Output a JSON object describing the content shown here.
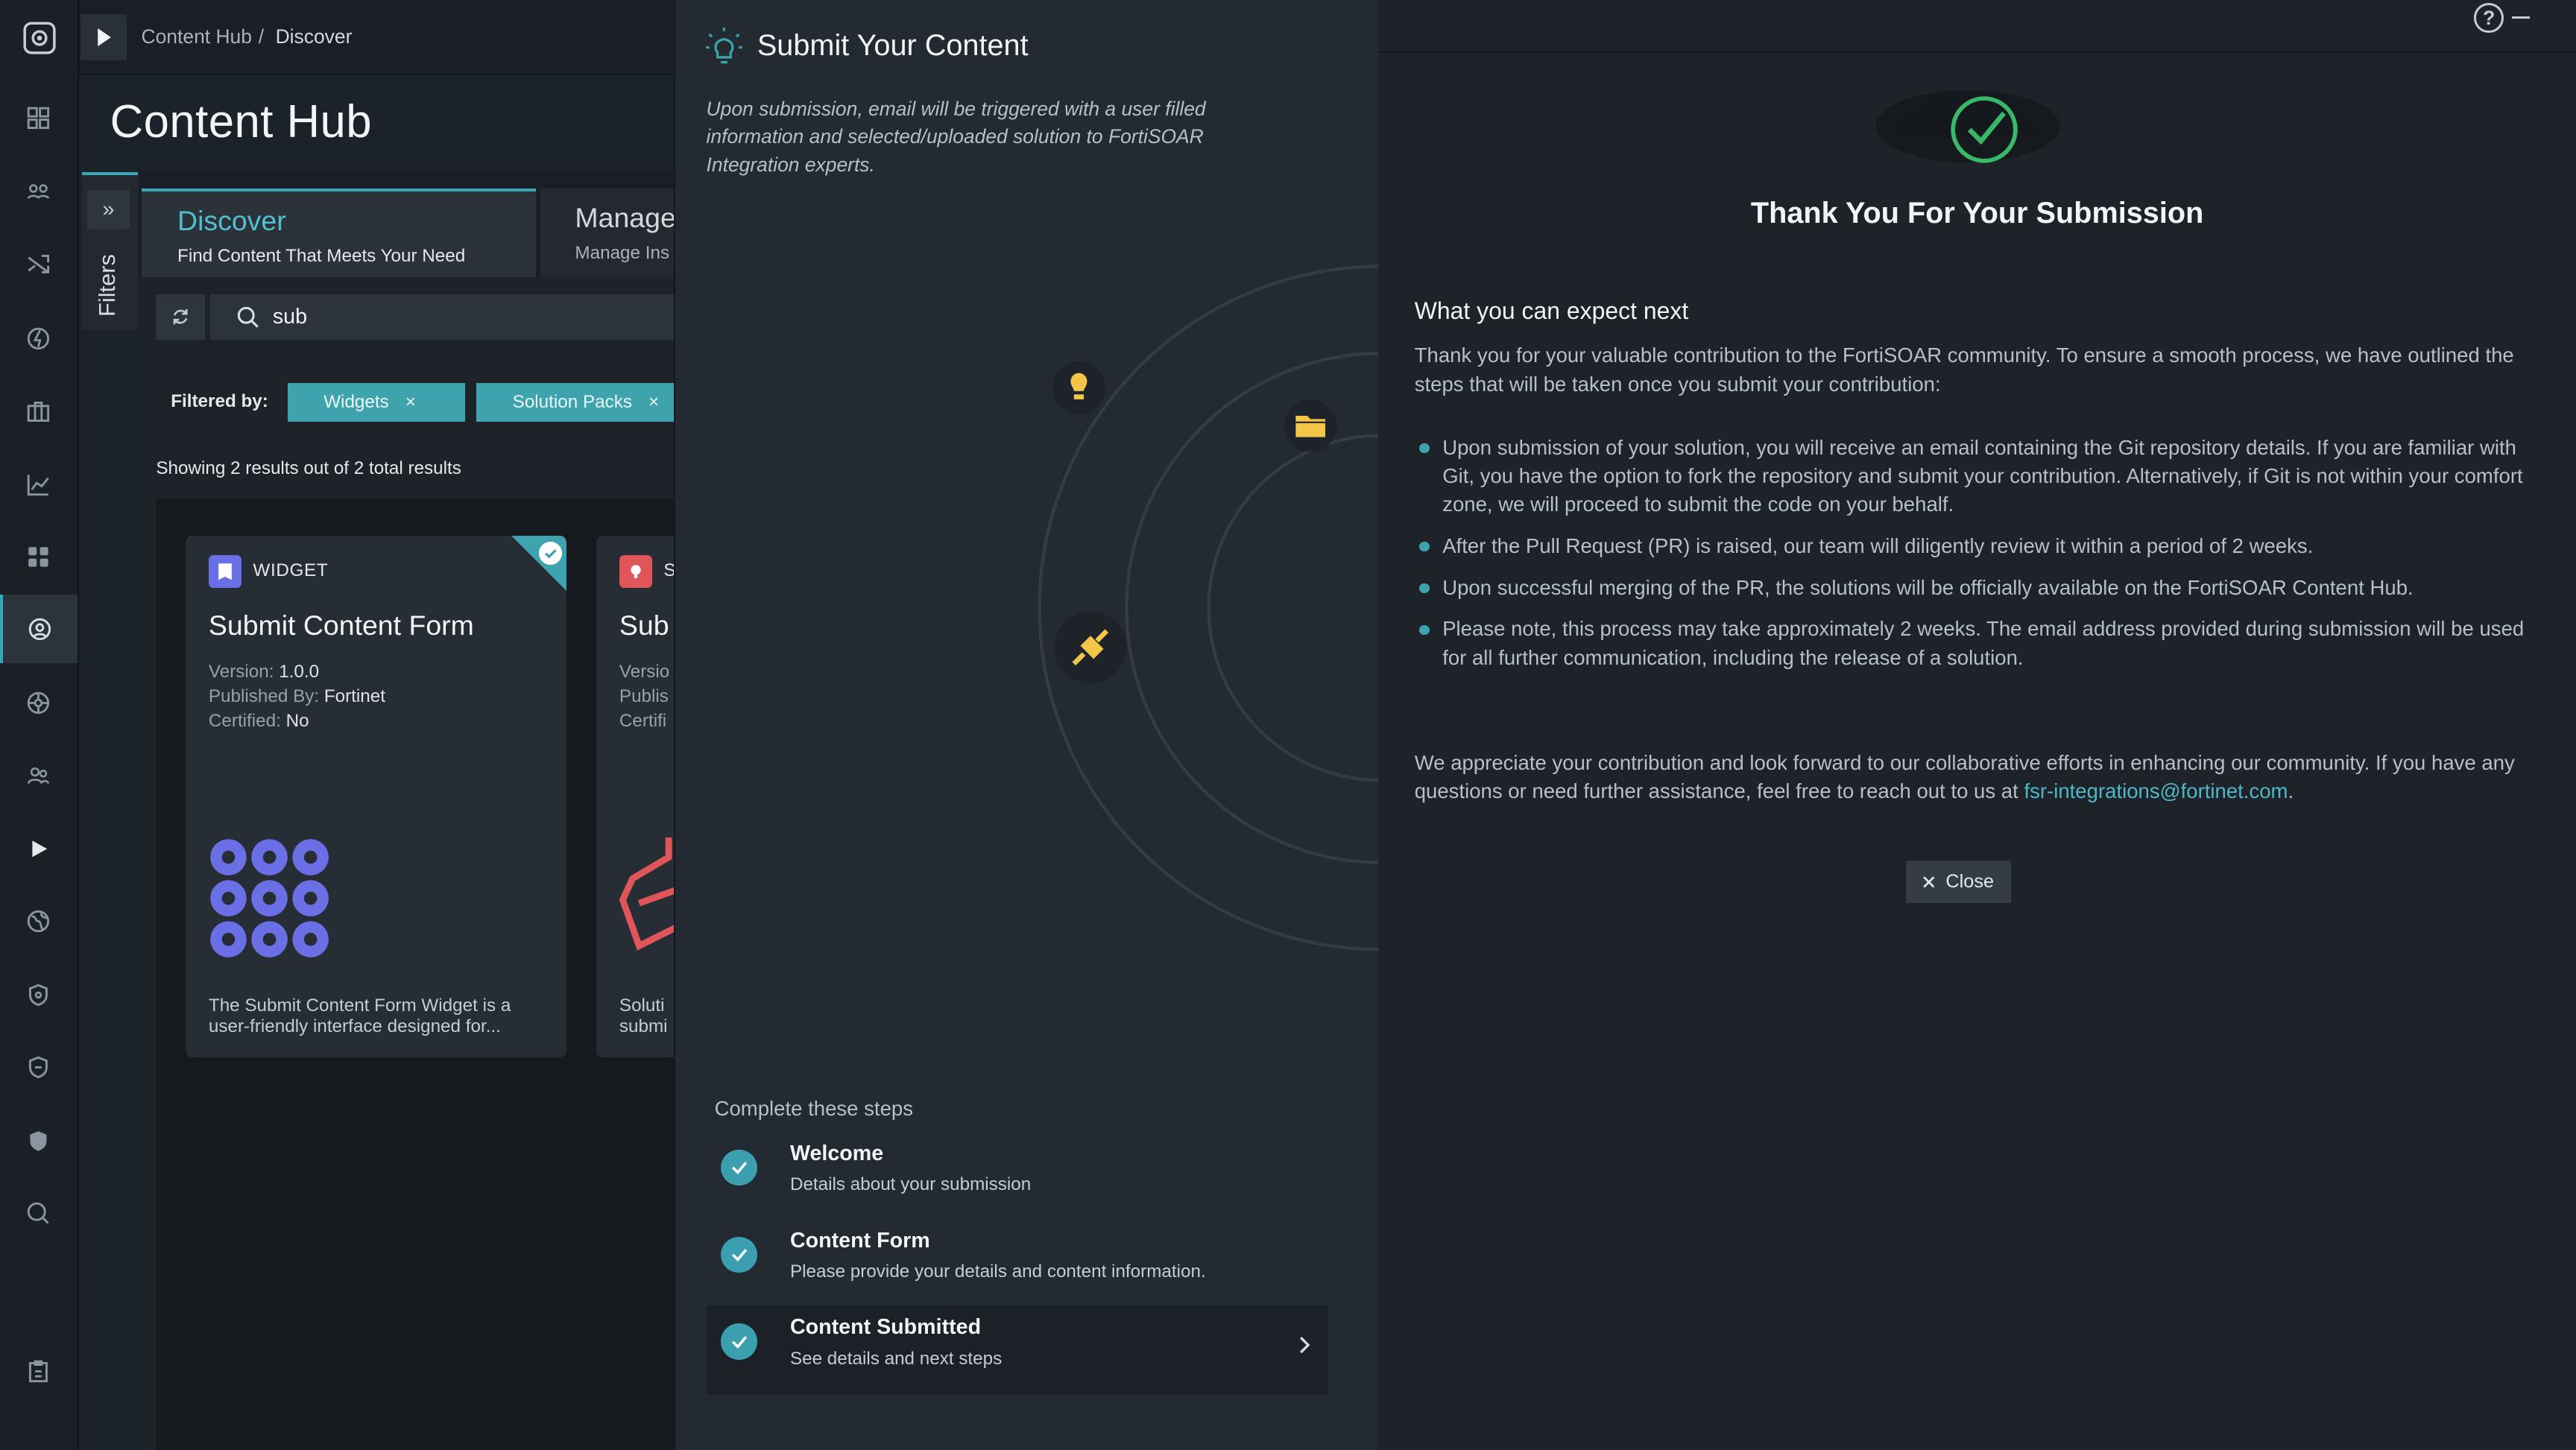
{
  "breadcrumb": {
    "item1": "Content Hub",
    "separator": "/",
    "item2": "Discover"
  },
  "page": {
    "title": "Content Hub"
  },
  "filters_panel": {
    "label": "Filters"
  },
  "tabs": [
    {
      "title": "Discover",
      "subtitle": "Find Content That Meets Your Need"
    },
    {
      "title": "Manage",
      "subtitle": "Manage Ins"
    }
  ],
  "search": {
    "value": "sub"
  },
  "filter_bar": {
    "label": "Filtered by:",
    "chips": [
      "Widgets",
      "Solution Packs"
    ],
    "remove_symbol": "×"
  },
  "results_text": "Showing 2 results out of 2 total results",
  "cards": [
    {
      "type": "WIDGET",
      "title": "Submit Content Form",
      "version_label": "Version:",
      "version": "1.0.0",
      "publisher_label": "Published By:",
      "publisher": "Fortinet",
      "certified_label": "Certified:",
      "certified": "No",
      "description": "The Submit Content Form Widget is a user-friendly interface designed for...",
      "color": "#6b6fe6"
    },
    {
      "type": "S",
      "title": "Sub",
      "version_label": "Versio",
      "publisher_label": "Publis",
      "certified_label": "Certifi",
      "description_line1": "Soluti",
      "description_line2": "submi",
      "color": "#e0555a"
    }
  ],
  "wizard": {
    "title": "Submit Your Content",
    "note": "Upon submission, email will be triggered with a user filled information and selected/uploaded solution to FortiSOAR Integration experts.",
    "steps_heading": "Complete these steps",
    "steps": [
      {
        "title": "Welcome",
        "subtitle": "Details about your submission"
      },
      {
        "title": "Content Form",
        "subtitle": "Please provide your details and content information."
      },
      {
        "title": "Content Submitted",
        "subtitle": "See details and next steps"
      }
    ]
  },
  "result": {
    "help_symbol": "?",
    "heading": "Thank You For Your Submission",
    "expect_title": "What you can expect next",
    "intro": "Thank you for your valuable contribution to the FortiSOAR community. To ensure a smooth process, we have outlined the steps that will be taken once you submit your contribution:",
    "bullets": [
      "Upon submission of your solution, you will receive an email containing the Git repository details. If you are familiar with Git, you have the option to fork the repository and submit your contribution. Alternatively, if Git is not within your comfort zone, we will proceed to submit the code on your behalf.",
      "After the Pull Request (PR) is raised, our team will diligently review it within a period of 2 weeks.",
      "Upon successful merging of the PR, the solutions will be officially available on the FortiSOAR Content Hub.",
      "Please note, this process may take approximately 2 weeks. The email address provided during submission will be used for all further communication, including the release of a solution."
    ],
    "closing_text": "We appreciate your contribution and look forward to our collaborative efforts in enhancing our community. If you have any questions or need further assistance, feel free to reach out to us at ",
    "email": "fsr-integrations@fortinet.com",
    "closing_end": ".",
    "close_label": "Close"
  },
  "colors": {
    "accent": "#3fa3ad",
    "success": "#3ab86a",
    "widget_purple": "#6b6fe6",
    "solution_red": "#e0555a",
    "bulb_yellow": "#f3c64a"
  },
  "icons": {
    "rail": [
      "dashboard-icon",
      "users-group-icon",
      "shuffle-icon",
      "lightning-icon",
      "briefcase-icon",
      "chart-icon",
      "apps-icon",
      "content-hub-icon",
      "network-icon",
      "people-icon",
      "play-icon",
      "globe-icon",
      "shield-icon",
      "shield-outline-icon",
      "shield-star-icon",
      "search-dollar-icon",
      "clipboard-icon"
    ]
  }
}
